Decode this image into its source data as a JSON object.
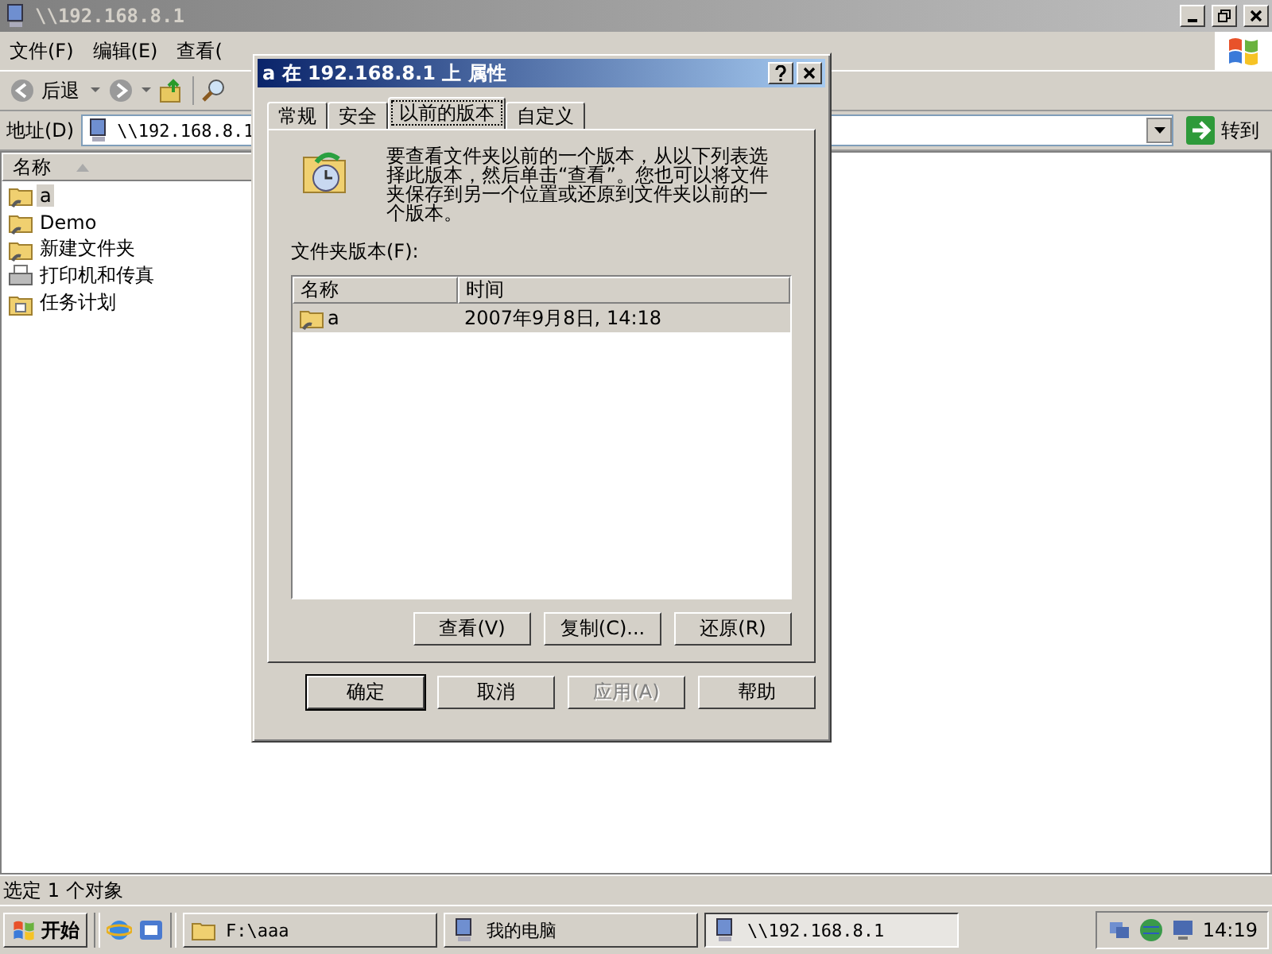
{
  "window": {
    "title": "\\\\192.168.8.1"
  },
  "menu": [
    "文件(F)",
    "编辑(E)",
    "查看("
  ],
  "toolbar": {
    "back": "后退"
  },
  "address": {
    "label": "地址(D)",
    "value": "\\\\192.168.8.1",
    "go": "转到"
  },
  "file_list": {
    "column": "名称",
    "items": [
      {
        "name": "a",
        "kind": "share",
        "selected": true
      },
      {
        "name": "Demo",
        "kind": "share",
        "selected": false
      },
      {
        "name": "新建文件夹",
        "kind": "share",
        "selected": false
      },
      {
        "name": "打印机和传真",
        "kind": "printer",
        "selected": false
      },
      {
        "name": "任务计划",
        "kind": "tasks",
        "selected": false
      }
    ]
  },
  "status_bar": "选定 1 个对象",
  "dialog": {
    "title": "a 在 192.168.8.1 上 属性",
    "tabs": [
      {
        "label": "常规",
        "selected": false
      },
      {
        "label": "安全",
        "selected": false
      },
      {
        "label": "以前的版本",
        "selected": true
      },
      {
        "label": "自定义",
        "selected": false
      }
    ],
    "description": "要查看文件夹以前的一个版本，从以下列表选择此版本，然后单击“查看”。您也可以将文件夹保存到另一个位置或还原到文件夹以前的一个版本。",
    "versions_label": "文件夹版本(F):",
    "columns": [
      "名称",
      "时间"
    ],
    "versions": [
      {
        "name": "a",
        "time": "2007年9月8日, 14:18",
        "selected": true
      }
    ],
    "actions": [
      "查看(V)",
      "复制(C)...",
      "还原(R)"
    ],
    "buttons": [
      {
        "label": "确定",
        "disabled": false
      },
      {
        "label": "取消",
        "disabled": false
      },
      {
        "label": "应用(A)",
        "disabled": true
      },
      {
        "label": "帮助",
        "disabled": false
      }
    ]
  },
  "taskbar": {
    "start": "开始",
    "tasks": [
      {
        "label": "F:\\aaa",
        "kind": "folder",
        "selected": false
      },
      {
        "label": "我的电脑",
        "kind": "computer",
        "selected": false
      },
      {
        "label": "\\\\192.168.8.1",
        "kind": "computer",
        "selected": true
      }
    ],
    "clock": "14:19"
  }
}
